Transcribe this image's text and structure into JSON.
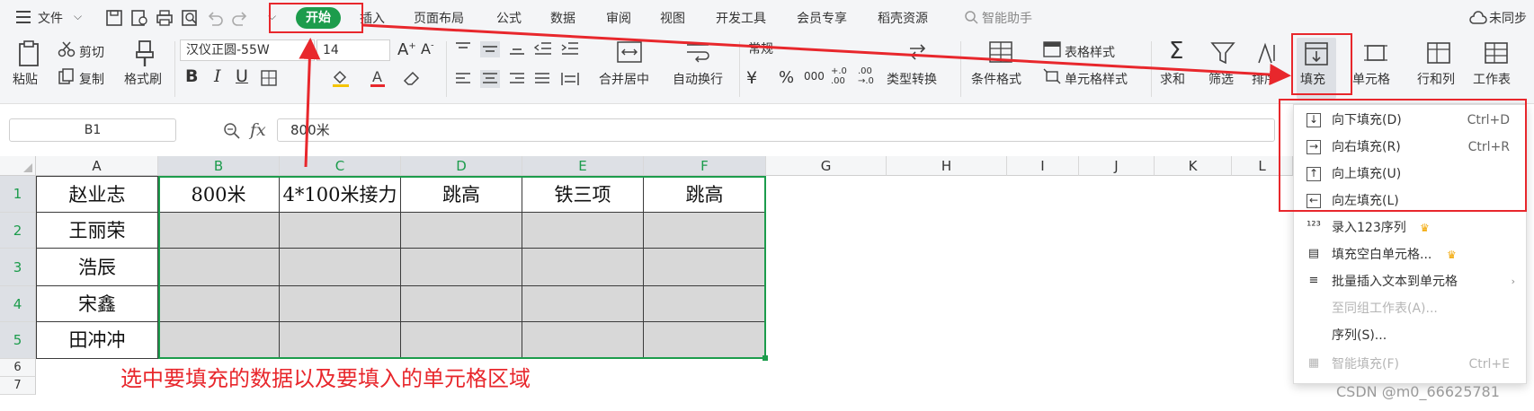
{
  "menubar": {
    "file": "文件",
    "tabs": [
      "开始",
      "插入",
      "页面布局",
      "公式",
      "数据",
      "审阅",
      "视图",
      "开发工具",
      "会员专享",
      "稻壳资源"
    ],
    "assistant": "智能助手",
    "sync": "未同步"
  },
  "ribbon": {
    "paste": "粘贴",
    "cut": "剪切",
    "copy": "复制",
    "format_painter": "格式刷",
    "font_name": "汉仪正圆-55W",
    "font_size": "14",
    "merge_center": "合并居中",
    "wrap": "自动换行",
    "number_format": "常规",
    "type_convert": "类型转换",
    "cond_format": "条件格式",
    "table_style": "表格样式",
    "cell_style": "单元格样式",
    "sum": "求和",
    "filter": "筛选",
    "sort": "排序",
    "fill": "填充",
    "cell": "单元格",
    "rowcol": "行和列",
    "sheet": "工作表"
  },
  "formula": {
    "name_box": "B1",
    "fx": "fx",
    "value": "800米"
  },
  "grid": {
    "columns": [
      "A",
      "B",
      "C",
      "D",
      "E",
      "F",
      "G",
      "H",
      "I",
      "J",
      "K",
      "L"
    ],
    "rows": [
      "1",
      "2",
      "3",
      "4",
      "5",
      "6",
      "7"
    ],
    "cells": [
      [
        "赵业志",
        "800米",
        "4*100米接力",
        "跳高",
        "铁三项",
        "跳高"
      ],
      [
        "王丽荣",
        "",
        "",
        "",
        "",
        ""
      ],
      [
        "浩辰",
        "",
        "",
        "",
        "",
        ""
      ],
      [
        "宋鑫",
        "",
        "",
        "",
        "",
        ""
      ],
      [
        "田冲冲",
        "",
        "",
        "",
        "",
        ""
      ]
    ]
  },
  "fill_menu": {
    "items": [
      {
        "label": "向下填充(D)",
        "shortcut": "Ctrl+D",
        "icon": "fill-down-icon"
      },
      {
        "label": "向右填充(R)",
        "shortcut": "Ctrl+R",
        "icon": "fill-right-icon"
      },
      {
        "label": "向上填充(U)",
        "shortcut": "",
        "icon": "fill-up-icon"
      },
      {
        "label": "向左填充(L)",
        "shortcut": "",
        "icon": "fill-left-icon"
      },
      {
        "label": "录入123序列",
        "shortcut": "",
        "icon": "series-123-icon"
      },
      {
        "label": "填充空白单元格...",
        "shortcut": "",
        "icon": "fill-blank-icon"
      },
      {
        "label": "批量插入文本到单元格",
        "shortcut": "",
        "icon": "batch-insert-icon"
      },
      {
        "label": "至同组工作表(A)...",
        "shortcut": "",
        "icon": ""
      },
      {
        "label": "序列(S)...",
        "shortcut": "",
        "icon": ""
      },
      {
        "label": "智能填充(F)",
        "shortcut": "Ctrl+E",
        "icon": "smart-fill-icon"
      }
    ]
  },
  "annotation": "选中要填充的数据以及要填入的单元格区域",
  "watermark": "CSDN @m0_66625781",
  "colors": {
    "accent_green": "#1c9c4c",
    "annotation_red": "#e8272c",
    "selected_fill": "#d8d8d8"
  }
}
